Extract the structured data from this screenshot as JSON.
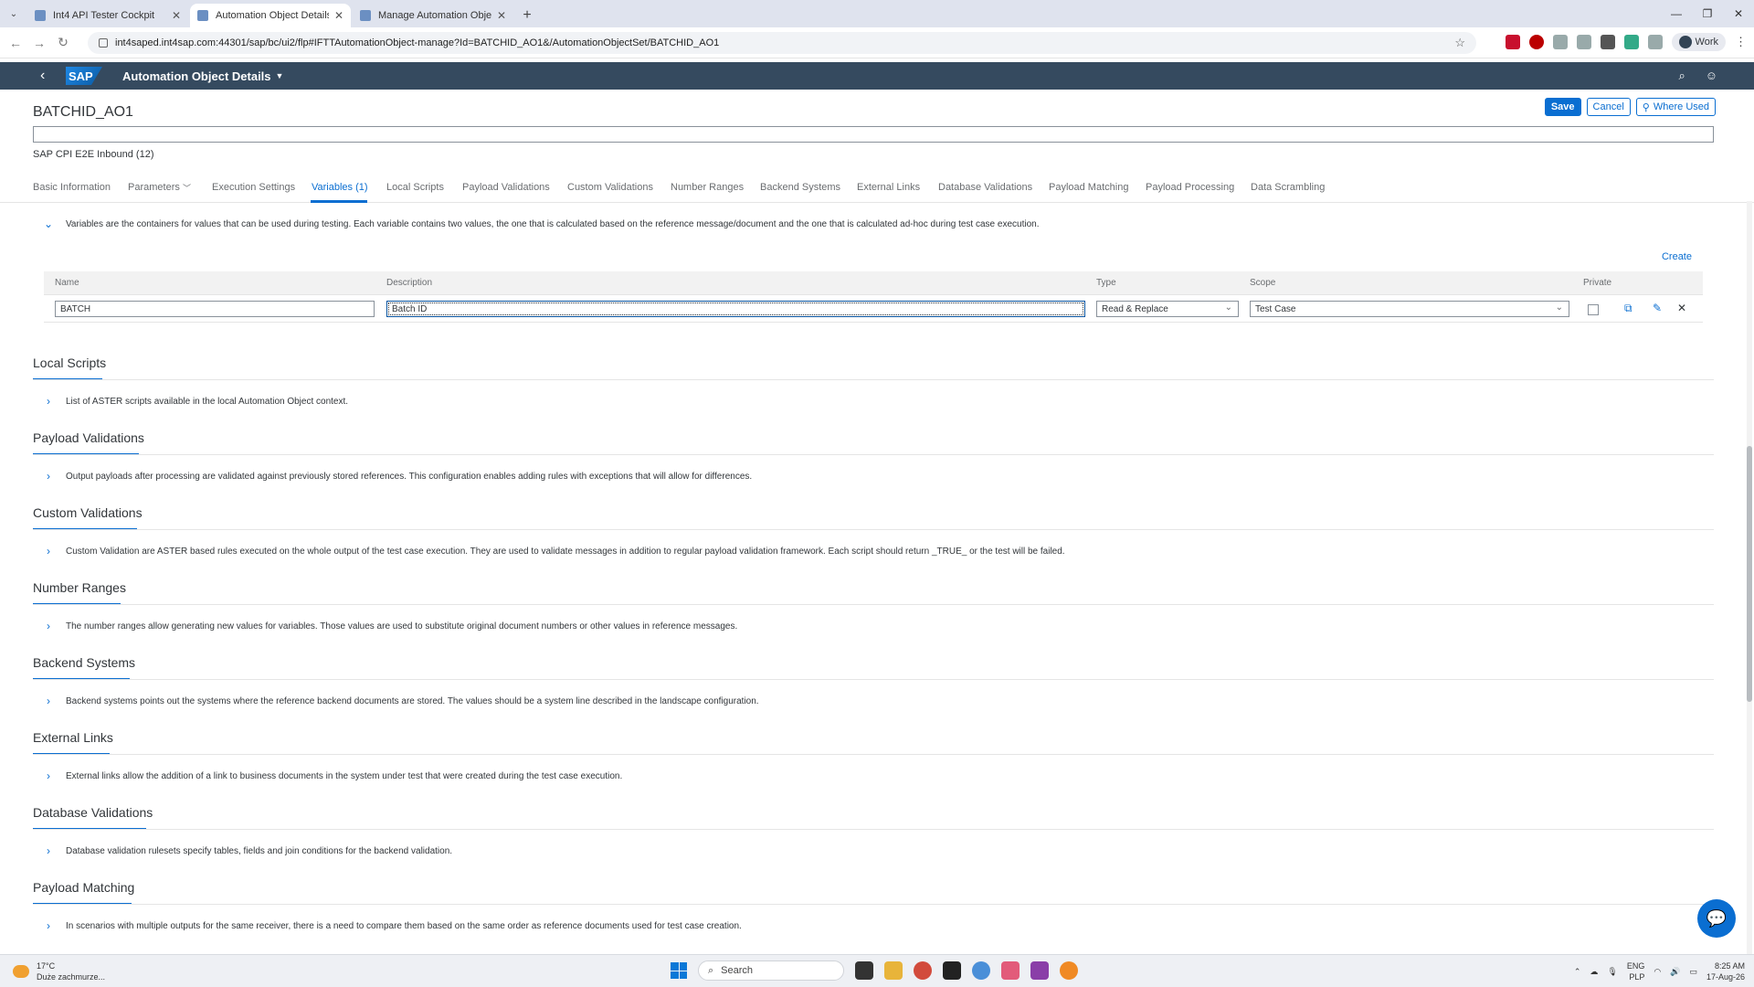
{
  "browser": {
    "tabs": [
      {
        "title": "Int4 API Tester Cockpit",
        "active": false
      },
      {
        "title": "Automation Object Details",
        "active": true
      },
      {
        "title": "Manage Automation Objects",
        "active": false
      }
    ],
    "url": "int4saped.int4sap.com:44301/sap/bc/ui2/flp#IFTTAutomationObject-manage?Id=BATCHID_AO1&/AutomationObjectSet/BATCHID_AO1",
    "profile_label": "Work"
  },
  "shell": {
    "app_title": "Automation Object Details",
    "logo_text": "SAP"
  },
  "header": {
    "object_title": "BATCHID_AO1",
    "subtitle": "SAP CPI E2E Inbound (12)",
    "save_label": "Save",
    "cancel_label": "Cancel",
    "where_used_label": "Where Used"
  },
  "anchors": [
    "Basic Information",
    "Parameters",
    "Execution Settings",
    "Variables (1)",
    "Local Scripts",
    "Payload Validations",
    "Custom Validations",
    "Number Ranges",
    "Backend Systems",
    "External Links",
    "Database Validations",
    "Payload Matching",
    "Payload Processing",
    "Data Scrambling"
  ],
  "variables": {
    "description": "Variables are the containers for values that can be used during testing. Each variable contains two values, the one that is calculated based on the reference message/document and the one that is calculated ad-hoc during test case execution.",
    "create_label": "Create",
    "columns": {
      "name": "Name",
      "description": "Description",
      "type": "Type",
      "scope": "Scope",
      "private": "Private"
    },
    "row": {
      "name": "BATCH",
      "description": "Batch ID",
      "type": "Read & Replace",
      "scope": "Test Case",
      "private": false
    }
  },
  "sections": [
    {
      "title": "Local Scripts",
      "text": "List of ASTER scripts available in the local Automation Object context."
    },
    {
      "title": "Payload Validations",
      "text": "Output payloads after processing are validated against previously stored references. This configuration enables adding rules with exceptions that will allow for differences."
    },
    {
      "title": "Custom Validations",
      "text": "Custom Validation are ASTER based rules executed on the whole output of the test case execution. They are used to validate messages in addition to regular payload validation framework. Each script should return _TRUE_ or the test will be failed."
    },
    {
      "title": "Number Ranges",
      "text": "The number ranges allow generating new values for variables. Those values are used to substitute original document numbers or other values in reference messages."
    },
    {
      "title": "Backend Systems",
      "text": "Backend systems points out the systems where the reference backend documents are stored. The values should be a system line described in the landscape configuration."
    },
    {
      "title": "External Links",
      "text": "External links allow the addition of a link to business documents in the system under test that were created during the test case execution."
    },
    {
      "title": "Database Validations",
      "text": "Database validation rulesets specify tables, fields and join conditions for the backend validation."
    },
    {
      "title": "Payload Matching",
      "text": "In scenarios with multiple outputs for the same receiver, there is a need to compare them based on the same order as reference documents used for test case creation."
    }
  ],
  "taskbar": {
    "weather_temp": "17°C",
    "weather_desc": "Duże zachmurze...",
    "search_placeholder": "Search",
    "lang": "ENG",
    "lang_sub": "PLP",
    "time": "8:25 AM",
    "date": "17-Aug-26"
  },
  "colors": {
    "shell": "#354a5f",
    "accent": "#0a6ed1"
  }
}
